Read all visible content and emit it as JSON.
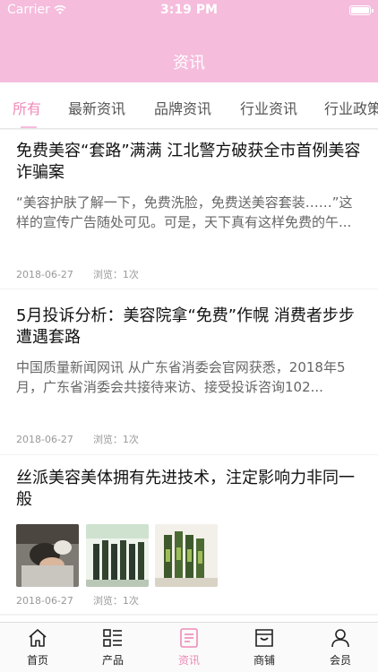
{
  "status": {
    "carrier": "Carrier",
    "time": "3:19 PM"
  },
  "nav": {
    "title": "资讯"
  },
  "tabs": [
    {
      "label": "所有",
      "active": true
    },
    {
      "label": "最新资讯",
      "active": false
    },
    {
      "label": "品牌资讯",
      "active": false
    },
    {
      "label": "行业资讯",
      "active": false
    },
    {
      "label": "行业政策",
      "active": false
    }
  ],
  "articles": [
    {
      "title": "免费美容“套路”满满 江北警方破获全市首例美容诈骗案",
      "summary": "“美容护肤了解一下，免费洗脸，免费送美容套装……”这样的宣传广告随处可见。可是，天下真有这样免费的午...",
      "date": "2018-06-27",
      "views": "浏览：1次"
    },
    {
      "title": "5月投诉分析：美容院拿“免费”作幌 消费者步步遭遇套路",
      "summary": "中国质量新闻网讯 从广东省消委会官网获悉，2018年5月，广东省消委会共接待来访、接受投诉咨询102...",
      "date": "2018-06-27",
      "views": "浏览：1次"
    },
    {
      "title": "丝派美容美体拥有先进技术，注定影响力非同一般",
      "date": "2018-06-27",
      "views": "浏览：1次"
    }
  ],
  "tabbar": [
    {
      "label": "首页",
      "icon": "home-icon"
    },
    {
      "label": "产品",
      "icon": "grid-list-icon"
    },
    {
      "label": "资讯",
      "icon": "news-icon",
      "active": true
    },
    {
      "label": "商铺",
      "icon": "shop-icon"
    },
    {
      "label": "会员",
      "icon": "user-icon"
    }
  ],
  "colors": {
    "accent": "#f5bcdc",
    "accent_text": "#f08ab8"
  }
}
